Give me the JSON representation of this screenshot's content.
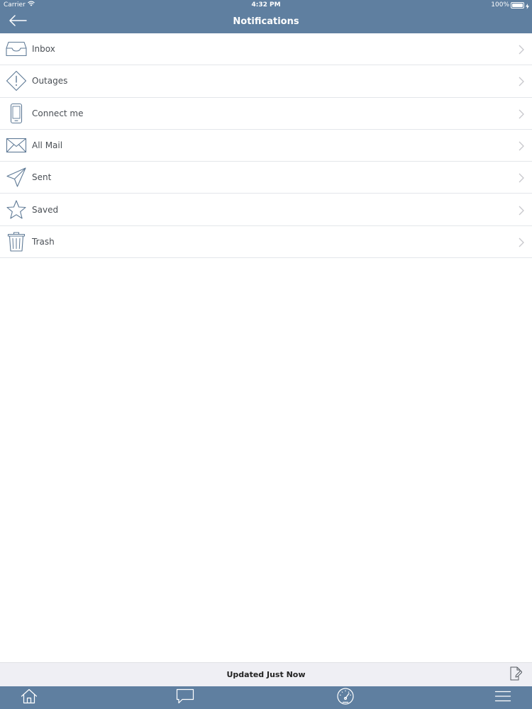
{
  "status_bar": {
    "carrier": "Carrier",
    "time": "4:32 PM",
    "battery": "100%",
    "battery_level": 1.0
  },
  "header": {
    "title": "Notifications",
    "back_icon": "arrow-left-icon"
  },
  "items": [
    {
      "label": "Inbox",
      "icon": "inbox-tray-icon"
    },
    {
      "label": "Outages",
      "icon": "warning-diamond-icon"
    },
    {
      "label": "Connect me",
      "icon": "phone-icon"
    },
    {
      "label": "All Mail",
      "icon": "envelope-icon"
    },
    {
      "label": "Sent",
      "icon": "paper-plane-icon"
    },
    {
      "label": "Saved",
      "icon": "star-icon"
    },
    {
      "label": "Trash",
      "icon": "trash-icon"
    }
  ],
  "update_bar": {
    "text": "Updated Just Now",
    "edit_icon": "edit-document-icon"
  },
  "tab_bar": {
    "tabs": [
      {
        "icon": "home-icon"
      },
      {
        "icon": "chat-bubble-icon"
      },
      {
        "icon": "speedometer-icon"
      },
      {
        "icon": "menu-icon"
      }
    ]
  },
  "colors": {
    "header_bg": "#5f7fa0",
    "icon_stroke": "#5f7a96",
    "label_text": "#4a4f55",
    "chevron": "#c7c7cc"
  }
}
